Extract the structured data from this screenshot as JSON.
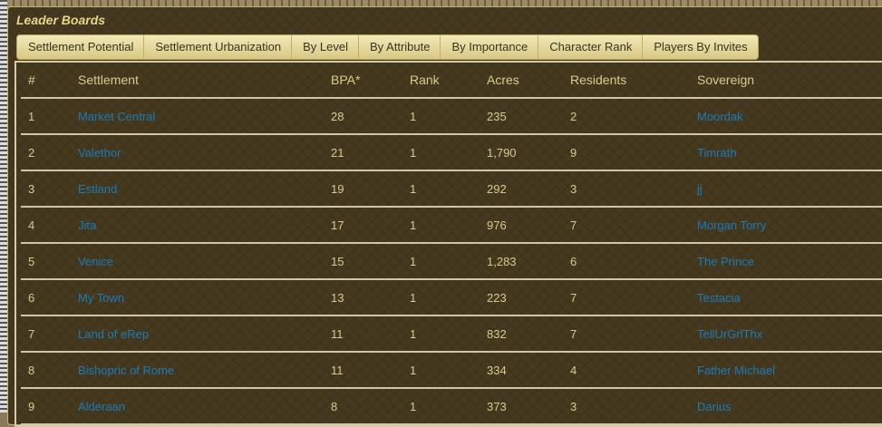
{
  "panel": {
    "title": "Leader Boards"
  },
  "tabs": [
    "Settlement Potential",
    "Settlement Urbanization",
    "By Level",
    "By Attribute",
    "By Importance",
    "Character Rank",
    "Players By Invites"
  ],
  "table": {
    "headers": [
      "#",
      "Settlement",
      "BPA*",
      "Rank",
      "Acres",
      "Residents",
      "Sovereign"
    ],
    "rows": [
      [
        "1",
        "Market Central",
        "28",
        "1",
        "235",
        "2",
        "Moordak"
      ],
      [
        "2",
        "Valethor",
        "21",
        "1",
        "1,790",
        "9",
        "Timrath"
      ],
      [
        "3",
        "Estland",
        "19",
        "1",
        "292",
        "3",
        "jj"
      ],
      [
        "4",
        "Jita",
        "17",
        "1",
        "976",
        "7",
        "Morgan Torry"
      ],
      [
        "5",
        "Venice",
        "15",
        "1",
        "1,283",
        "6",
        "The Prince"
      ],
      [
        "6",
        "My Town",
        "13",
        "1",
        "223",
        "7",
        "Testacia"
      ],
      [
        "7",
        "Land of eRep",
        "11",
        "1",
        "832",
        "7",
        "TellUrGrlThx"
      ],
      [
        "8",
        "Bishopric of Rome",
        "11",
        "1",
        "334",
        "4",
        "Father Michael"
      ],
      [
        "9",
        "Alderaan",
        "8",
        "1",
        "373",
        "3",
        "Darius"
      ]
    ]
  },
  "colors": {
    "background": "#45391f",
    "text": "#d9cb8e",
    "link": "#1d7ab5",
    "tab": "#e6dba0"
  }
}
